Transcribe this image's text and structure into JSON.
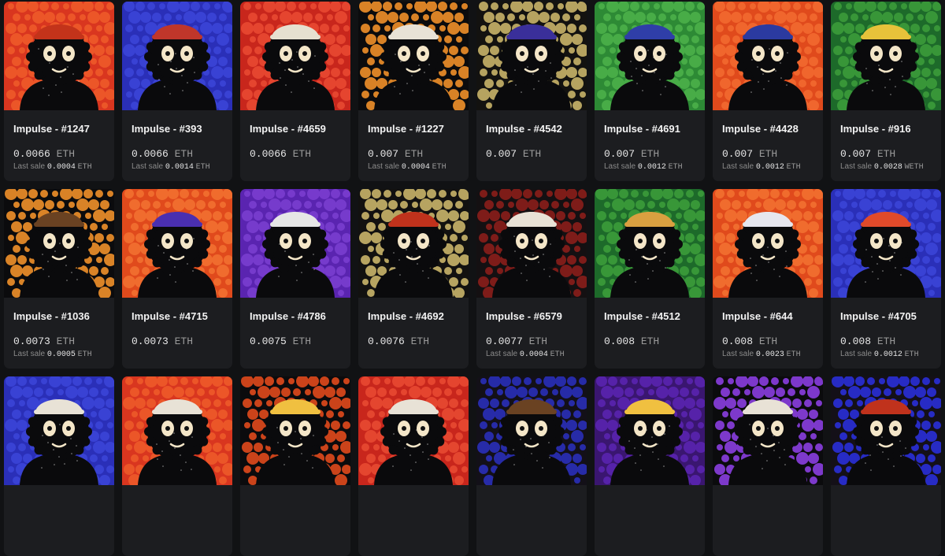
{
  "cards": [
    {
      "name": "Impulse - #1247",
      "price": "0.0066",
      "unit": "ETH",
      "last_label": "Last sale",
      "last_value": "0.0004",
      "last_unit": "ETH",
      "bg": "#d9361f",
      "dots": "#ee5a2a",
      "hat": "#c3331a"
    },
    {
      "name": "Impulse - #393",
      "price": "0.0066",
      "unit": "ETH",
      "last_label": "Last sale",
      "last_value": "0.0014",
      "last_unit": "ETH",
      "bg": "#2a2fb8",
      "dots": "#3b45d8",
      "hat": "#c0362a"
    },
    {
      "name": "Impulse - #4659",
      "price": "0.0066",
      "unit": "ETH",
      "last_label": "",
      "last_value": "",
      "last_unit": "",
      "bg": "#c8261c",
      "dots": "#e84a32",
      "hat": "#e6e0d0"
    },
    {
      "name": "Impulse - #1227",
      "price": "0.007",
      "unit": "ETH",
      "last_label": "Last sale",
      "last_value": "0.0004",
      "last_unit": "ETH",
      "bg": "#0b0b0d",
      "dots": "#f0902a",
      "hat": "#e8e2d6"
    },
    {
      "name": "Impulse - #4542",
      "price": "0.007",
      "unit": "ETH",
      "last_label": "",
      "last_value": "",
      "last_unit": "",
      "bg": "#131210",
      "dots": "#c9b46a",
      "hat": "#3a2f9a"
    },
    {
      "name": "Impulse - #4691",
      "price": "0.007",
      "unit": "ETH",
      "last_label": "Last sale",
      "last_value": "0.0012",
      "last_unit": "ETH",
      "bg": "#2d8a35",
      "dots": "#4cb04a",
      "hat": "#2f3ea8"
    },
    {
      "name": "Impulse - #4428",
      "price": "0.007",
      "unit": "ETH",
      "last_label": "Last sale",
      "last_value": "0.0012",
      "last_unit": "ETH",
      "bg": "#e04a1c",
      "dots": "#f26a30",
      "hat": "#2b3aa0"
    },
    {
      "name": "Impulse - #916",
      "price": "0.007",
      "unit": "ETH",
      "last_label": "Last sale",
      "last_value": "0.0028",
      "last_unit": "WETH",
      "bg": "#1d6a2a",
      "dots": "#3c9c3a",
      "hat": "#e7c23a"
    },
    {
      "name": "Impulse - #1036",
      "price": "0.0073",
      "unit": "ETH",
      "last_label": "Last sale",
      "last_value": "0.0005",
      "last_unit": "ETH",
      "bg": "#0b0b0d",
      "dots": "#f0902a",
      "hat": "#6a4222"
    },
    {
      "name": "Impulse - #4715",
      "price": "0.0073",
      "unit": "ETH",
      "last_label": "",
      "last_value": "",
      "last_unit": "",
      "bg": "#e04a1c",
      "dots": "#f27030",
      "hat": "#4a2fb0"
    },
    {
      "name": "Impulse - #4786",
      "price": "0.0075",
      "unit": "ETH",
      "last_label": "",
      "last_value": "",
      "last_unit": "",
      "bg": "#5a24b0",
      "dots": "#7a3ed0",
      "hat": "#e6e6e6"
    },
    {
      "name": "Impulse - #4692",
      "price": "0.0076",
      "unit": "ETH",
      "last_label": "",
      "last_value": "",
      "last_unit": "",
      "bg": "#121110",
      "dots": "#c9b46a",
      "hat": "#c0321c"
    },
    {
      "name": "Impulse - #6579",
      "price": "0.0077",
      "unit": "ETH",
      "last_label": "Last sale",
      "last_value": "0.0004",
      "last_unit": "ETH",
      "bg": "#141012",
      "dots": "#8a1e1a",
      "hat": "#e8e2d6"
    },
    {
      "name": "Impulse - #4512",
      "price": "0.008",
      "unit": "ETH",
      "last_label": "",
      "last_value": "",
      "last_unit": "",
      "bg": "#1d6a2a",
      "dots": "#3c9c3a",
      "hat": "#d9a040"
    },
    {
      "name": "Impulse - #644",
      "price": "0.008",
      "unit": "ETH",
      "last_label": "Last sale",
      "last_value": "0.0023",
      "last_unit": "ETH",
      "bg": "#e04a1c",
      "dots": "#f27030",
      "hat": "#e6e6ee"
    },
    {
      "name": "Impulse - #4705",
      "price": "0.008",
      "unit": "ETH",
      "last_label": "Last sale",
      "last_value": "0.0012",
      "last_unit": "ETH",
      "bg": "#2a2fb8",
      "dots": "#3b45d8",
      "hat": "#e04a2a"
    },
    {
      "name": "",
      "price": "",
      "unit": "",
      "last_label": "",
      "last_value": "",
      "last_unit": "",
      "bg": "#2a2fb8",
      "dots": "#3b45d8",
      "hat": "#e8e2d6"
    },
    {
      "name": "",
      "price": "",
      "unit": "",
      "last_label": "",
      "last_value": "",
      "last_unit": "",
      "bg": "#d9361f",
      "dots": "#ee5a2a",
      "hat": "#e8e2d6"
    },
    {
      "name": "",
      "price": "",
      "unit": "",
      "last_label": "",
      "last_value": "",
      "last_unit": "",
      "bg": "#0b0b0d",
      "dots": "#e04a1c",
      "hat": "#f0c040"
    },
    {
      "name": "",
      "price": "",
      "unit": "",
      "last_label": "",
      "last_value": "",
      "last_unit": "",
      "bg": "#c8261c",
      "dots": "#e84a32",
      "hat": "#e8e2d6"
    },
    {
      "name": "",
      "price": "",
      "unit": "",
      "last_label": "",
      "last_value": "",
      "last_unit": "",
      "bg": "#131018",
      "dots": "#2a2fb8",
      "hat": "#6a4222"
    },
    {
      "name": "",
      "price": "",
      "unit": "",
      "last_label": "",
      "last_value": "",
      "last_unit": "",
      "bg": "#3a1670",
      "dots": "#5a24b0",
      "hat": "#f0c040"
    },
    {
      "name": "",
      "price": "",
      "unit": "",
      "last_label": "",
      "last_value": "",
      "last_unit": "",
      "bg": "#0b0b0d",
      "dots": "#8a3ee0",
      "hat": "#e8e2d6"
    },
    {
      "name": "",
      "price": "",
      "unit": "",
      "last_label": "",
      "last_value": "",
      "last_unit": "",
      "bg": "#141018",
      "dots": "#2a2fd8",
      "hat": "#c0321c"
    }
  ]
}
